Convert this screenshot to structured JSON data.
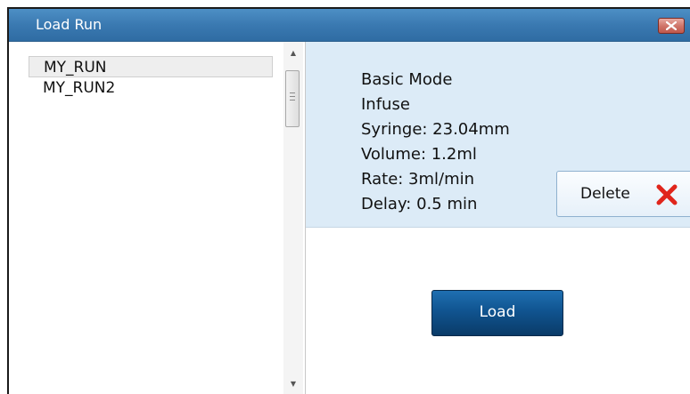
{
  "window": {
    "title": "Load Run"
  },
  "runs": {
    "items": [
      {
        "label": "MY_RUN",
        "selected": true
      },
      {
        "label": "MY_RUN2",
        "selected": false
      }
    ]
  },
  "details": {
    "mode": "Basic Mode",
    "direction": "Infuse",
    "syringe": "Syringe: 23.04mm",
    "volume": "Volume: 1.2ml",
    "rate": "Rate: 3ml/min",
    "delay": "Delay: 0.5 min"
  },
  "actions": {
    "delete_label": "Delete",
    "load_label": "Load"
  },
  "icons": {
    "close": "close-icon",
    "delete": "red-x-icon",
    "scroll_up": "arrow-up-icon",
    "scroll_down": "arrow-down-icon"
  },
  "colors": {
    "titlebar": "#3a79b1",
    "detail_background": "#dcebf7",
    "load_button": "#105490",
    "delete_icon": "#e0251b"
  }
}
